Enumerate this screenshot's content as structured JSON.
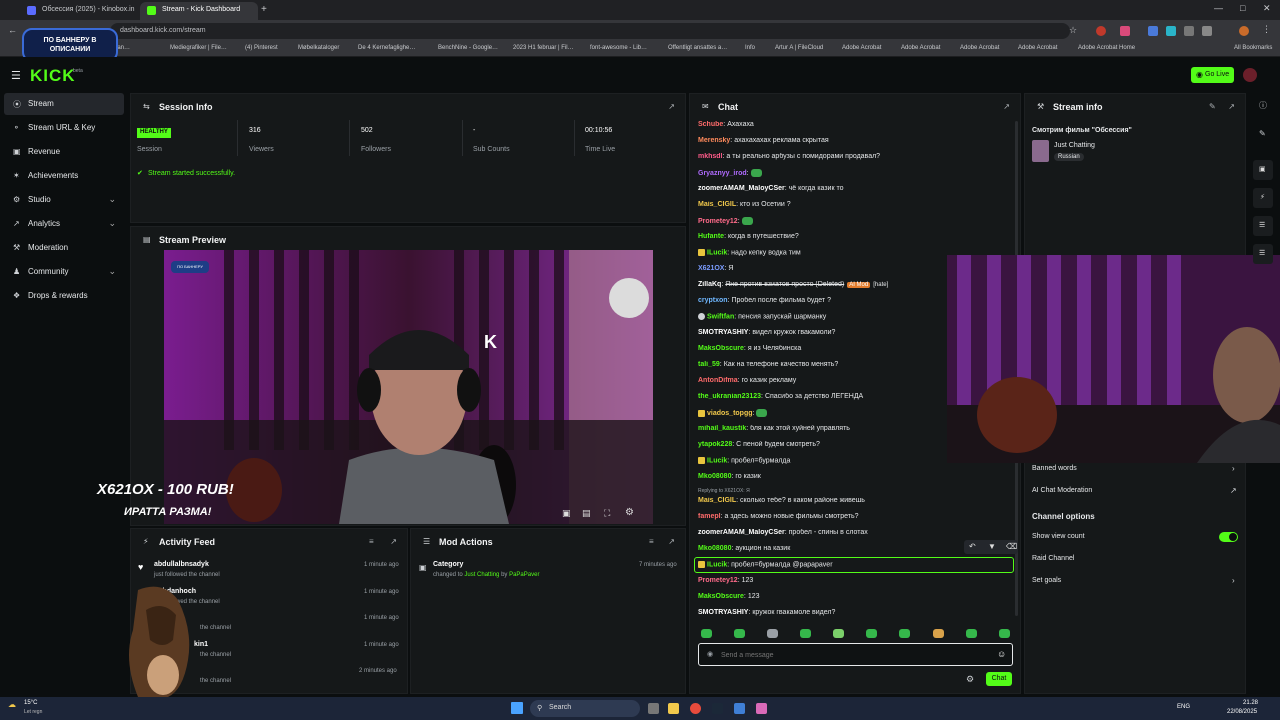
{
  "browser": {
    "tabs": [
      {
        "title": "Обсессия (2025) - Kinobox.in",
        "active": false
      },
      {
        "title": "Stream - Kick Dashboard",
        "active": true
      }
    ],
    "new_tab": "+",
    "url": "dashboard.kick.com/stream",
    "bookmarks": [
      "Sjællan…",
      "Mediegrafiker | File…",
      "(4) Pinterest",
      "Møbelkataloger",
      "De 4 Kernefaglighe…",
      "BenchNine - Google…",
      "2023 H1 februar | Fil…",
      "font-awesome - Lib…",
      "Offentligt ansattes a…",
      "Info",
      "Artur A | FileCloud",
      "Adobe Acrobat",
      "Adobe Acrobat",
      "Adobe Acrobat",
      "Adobe Acrobat",
      "Adobe Acrobat Home"
    ],
    "all_bookmarks": "All Bookmarks",
    "promo_text": "ПО БАННЕРУ В ОПИСАНИИ"
  },
  "header": {
    "logo": "KICK",
    "logo_sup": "beta",
    "go_live": "Go Live",
    "menu_icon": "hamburger-icon"
  },
  "sidebar": {
    "items": [
      {
        "label": "Stream",
        "icon": "broadcast-icon",
        "active": true,
        "expandable": false
      },
      {
        "label": "Stream URL & Key",
        "icon": "key-icon",
        "active": false,
        "expandable": false
      },
      {
        "label": "Revenue",
        "icon": "revenue-icon",
        "active": false,
        "expandable": false
      },
      {
        "label": "Achievements",
        "icon": "trophy-icon",
        "active": false,
        "expandable": false
      },
      {
        "label": "Studio",
        "icon": "studio-icon",
        "active": false,
        "expandable": true
      },
      {
        "label": "Analytics",
        "icon": "analytics-icon",
        "active": false,
        "expandable": true
      },
      {
        "label": "Moderation",
        "icon": "moderation-icon",
        "active": false,
        "expandable": false
      },
      {
        "label": "Community",
        "icon": "community-icon",
        "active": false,
        "expandable": true
      },
      {
        "label": "Drops & rewards",
        "icon": "drops-icon",
        "active": false,
        "expandable": false
      }
    ]
  },
  "session": {
    "title": "Session Info",
    "health": "HEALTHY",
    "stats": [
      {
        "value": "",
        "label": "Session"
      },
      {
        "value": "316",
        "label": "Viewers"
      },
      {
        "value": "502",
        "label": "Followers"
      },
      {
        "value": "-",
        "label": "Sub Counts"
      },
      {
        "value": "00:10:56",
        "label": "Time Live"
      }
    ],
    "status_message": "Stream started successfully."
  },
  "preview": {
    "title": "Stream Preview",
    "overlay_top": "ПО БАННЕРУ",
    "overlay_line1": "X621OX - 100 RUB!",
    "overlay_line2": "ИРАТТА РАЗМА!",
    "cap_logo": "K"
  },
  "activity": {
    "title": "Activity Feed",
    "items": [
      {
        "user": "abdullalbnsadyk",
        "action": "just followed the channel",
        "time": "1 minute ago"
      },
      {
        "user": "bohdanhoch",
        "action": "just followed the channel",
        "time": "1 minute ago"
      },
      {
        "user": "",
        "action": "the channel",
        "time": "1 minute ago"
      },
      {
        "user": "kin1",
        "action": "the channel",
        "time": "1 minute ago"
      },
      {
        "user": "",
        "action": "the channel",
        "time": "2 minutes ago"
      }
    ]
  },
  "mod_actions": {
    "title": "Mod Actions",
    "items": [
      {
        "type": "Category",
        "prefix": "changed to",
        "target": "Just Chatting",
        "by_word": "by",
        "by": "PaPaPaver",
        "time": "7 minutes ago"
      }
    ]
  },
  "chat": {
    "title": "Chat",
    "messages": [
      {
        "user": "Schube",
        "color": "#ff6b6b",
        "text": "Ахахаха"
      },
      {
        "user": "Merensky",
        "color": "#ff8a5c",
        "text": "ахахахахах реклама скрытая"
      },
      {
        "user": "mkhsdl",
        "color": "#ff5c8a",
        "text": "а ты реально арбузы с помидорами продавал?"
      },
      {
        "user": "Gryaznyy_irod",
        "color": "#b06bff",
        "text": ""
      },
      {
        "user": "zoomerAMAM_MaloyCSer",
        "color": "#ffffff",
        "text": "чё когда казик то"
      },
      {
        "user": "Mais_CIGIL",
        "color": "#f2c94c",
        "text": "кто из Осетии ?"
      },
      {
        "user": "Prometey12",
        "color": "#ff6b8a",
        "text": ""
      },
      {
        "user": "Hufante",
        "color": "#53fc18",
        "text": "когда в путешествие?"
      },
      {
        "user": "ILucik",
        "color": "#53fc18",
        "text": "надо кепку водка тим"
      },
      {
        "user": "X621OX",
        "color": "#7b9cff",
        "text": "Я"
      },
      {
        "user": "ZillaKq",
        "color": "#ffffff",
        "text": "Яне против взиатов просто (Deleted)",
        "tag": "AI Mod",
        "extra": "[hate]"
      },
      {
        "user": "cryptxon",
        "color": "#6fb7ff",
        "text": "Пробел после фильма будет ?"
      },
      {
        "user": "Swiftfan",
        "color": "#53fc18",
        "text": "пенсия запускай шарманку"
      },
      {
        "user": "SMOTRYASHIY",
        "color": "#ffffff",
        "text": "видел кружок гвакамоли?"
      },
      {
        "user": "MaksObscure",
        "color": "#53fc18",
        "text": "я из Челябинска"
      },
      {
        "user": "tali_59",
        "color": "#53fc18",
        "text": "Как на телефоне качество менять?"
      },
      {
        "user": "AntonDifma",
        "color": "#ff6b6b",
        "text": "го казик рекламу"
      },
      {
        "user": "the_ukranian23123",
        "color": "#53fc18",
        "text": "Спасибо за детство ЛЕГЕНДА"
      },
      {
        "user": "viados_topgg",
        "color": "#f2c94c",
        "text": ""
      },
      {
        "user": "mihail_kaustik",
        "color": "#53fc18",
        "text": "бля как этой хуйней управлять"
      },
      {
        "user": "ytapok228",
        "color": "#53fc18",
        "text": "С пеной будем смотреть?"
      },
      {
        "user": "ILucik",
        "color": "#53fc18",
        "text": "пробел=бурмалда"
      },
      {
        "user": "Mko08080",
        "color": "#53fc18",
        "text": "го казик"
      },
      {
        "user": "Mais_CIGIL",
        "color": "#f2c94c",
        "text": "сколько тебе? в каком районе живешь",
        "reply": "Replying to X621OX: Я"
      },
      {
        "user": "famepl",
        "color": "#ff6b6b",
        "text": "а здесь можно новые фильмы смотреть?"
      },
      {
        "user": "zoomerAMAM_MaloyCSer",
        "color": "#ffffff",
        "text": "пробел - спины в слотах"
      },
      {
        "user": "Mko08080",
        "color": "#53fc18",
        "text": "аукцион на казик"
      },
      {
        "user": "ILucik",
        "color": "#53fc18",
        "text": "пробел=бурмалда @papapaver"
      },
      {
        "user": "Prometey12",
        "color": "#ff6b8a",
        "text": "123"
      },
      {
        "user": "MaksObscure",
        "color": "#53fc18",
        "text": "123"
      },
      {
        "user": "SMOTRYASHIY",
        "color": "#ffffff",
        "text": "кружок гвакамоле видел?"
      }
    ],
    "input_placeholder": "Send a message",
    "send_label": "Chat"
  },
  "stream_info": {
    "title": "Stream info",
    "stream_title": "Смотрим фильм \"Обсессия\"",
    "category": "Just Chatting",
    "language": "Russian",
    "banned_words": "Banned words",
    "ai_moderation": "AI Chat Moderation",
    "channel_options": "Channel options",
    "show_view_count": "Show view count",
    "raid_channel": "Raid Channel",
    "set_goals": "Set goals"
  },
  "taskbar": {
    "weather_temp": "15°C",
    "weather_desc": "Let regn",
    "search": "Search",
    "lang": "ENG",
    "time": "21.28",
    "date": "22/08/2025"
  },
  "colors": {
    "accent": "#53fc18",
    "panel": "#151819",
    "background": "#0b0e0f"
  }
}
